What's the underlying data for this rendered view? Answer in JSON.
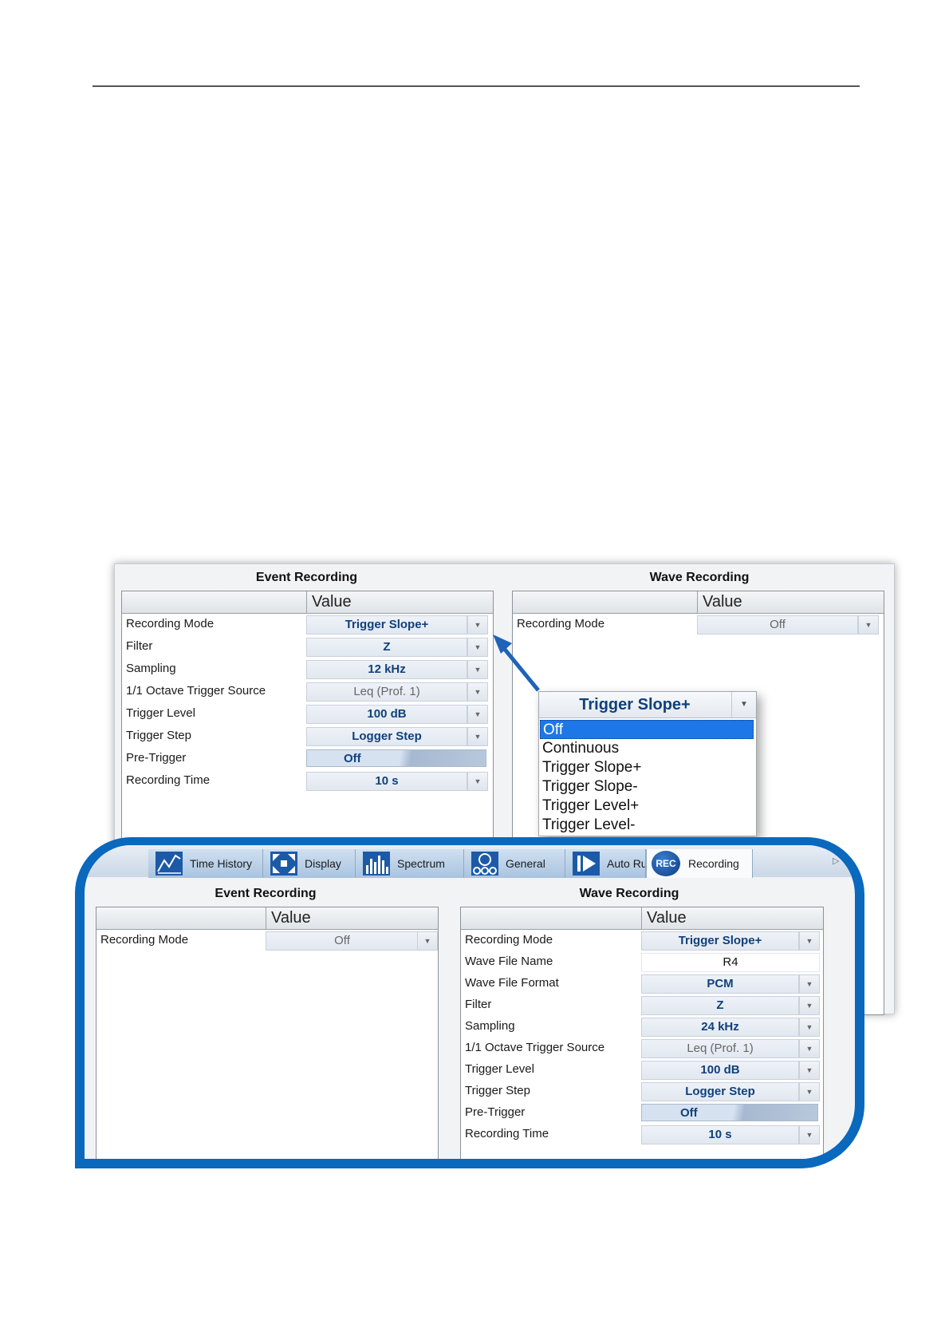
{
  "top_panel": {
    "event": {
      "title": "Event Recording",
      "value_header": "Value",
      "rows": [
        {
          "label": "Recording Mode",
          "value": "Trigger Slope+"
        },
        {
          "label": "Filter",
          "value": "Z"
        },
        {
          "label": "Sampling",
          "value": "12 kHz"
        },
        {
          "label": "1/1 Octave Trigger Source",
          "value": "Leq (Prof. 1)"
        },
        {
          "label": "Trigger Level",
          "value": "100 dB"
        },
        {
          "label": "Trigger Step",
          "value": "Logger Step"
        },
        {
          "label": "Pre-Trigger",
          "value": "Off"
        },
        {
          "label": "Recording Time",
          "value": "10 s"
        }
      ]
    },
    "wave": {
      "title": "Wave Recording",
      "value_header": "Value",
      "rows": [
        {
          "label": "Recording Mode",
          "value": "Off"
        }
      ]
    },
    "dropdown": {
      "selected": "Trigger Slope+",
      "options": [
        "Off",
        "Continuous",
        "Trigger Slope+",
        "Trigger Slope-",
        "Trigger Level+",
        "Trigger Level-"
      ],
      "highlighted": "Off"
    }
  },
  "tabs": [
    {
      "label": "Time History",
      "icon": "time-history-chart-icon"
    },
    {
      "label": "Display",
      "icon": "display-expand-icon"
    },
    {
      "label": "Spectrum",
      "icon": "spectrum-bars-icon"
    },
    {
      "label": "General",
      "icon": "general-gears-icon"
    },
    {
      "label": "Auto Run",
      "icon": "auto-run-play-icon"
    },
    {
      "label": "Recording",
      "icon": "rec-icon",
      "icon_text": "REC"
    }
  ],
  "bottom_panel": {
    "event": {
      "title": "Event Recording",
      "value_header": "Value",
      "rows": [
        {
          "label": "Recording Mode",
          "value": "Off"
        }
      ]
    },
    "wave": {
      "title": "Wave Recording",
      "value_header": "Value",
      "rows": [
        {
          "label": "Recording Mode",
          "value": "Trigger Slope+"
        },
        {
          "label": "Wave File Name",
          "value": "R4"
        },
        {
          "label": "Wave File Format",
          "value": "PCM"
        },
        {
          "label": "Filter",
          "value": "Z"
        },
        {
          "label": "Sampling",
          "value": "24 kHz"
        },
        {
          "label": "1/1 Octave Trigger Source",
          "value": "Leq (Prof. 1)"
        },
        {
          "label": "Trigger Level",
          "value": "100 dB"
        },
        {
          "label": "Trigger Step",
          "value": "Logger Step"
        },
        {
          "label": "Pre-Trigger",
          "value": "Off"
        },
        {
          "label": "Recording Time",
          "value": "10 s"
        }
      ]
    }
  },
  "colors": {
    "accent_blue": "#0a68bd",
    "value_text": "#10407c",
    "highlight": "#1e77e6"
  }
}
